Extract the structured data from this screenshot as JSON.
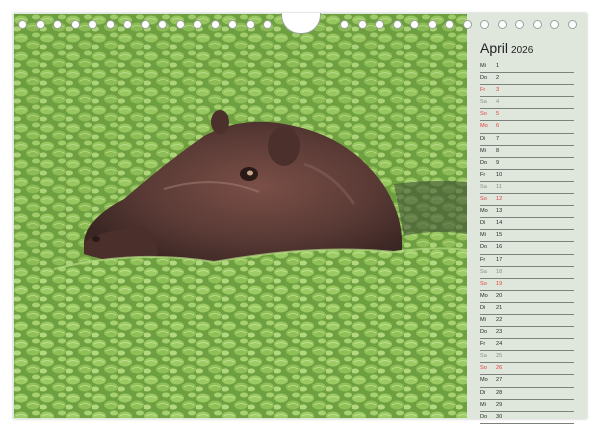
{
  "calendar": {
    "month": "April",
    "year": "2026",
    "days": [
      {
        "dn": "Mi",
        "num": "1",
        "type": "wd"
      },
      {
        "dn": "Do",
        "num": "2",
        "type": "wd"
      },
      {
        "dn": "Fr",
        "num": "3",
        "type": "holiday"
      },
      {
        "dn": "Sa",
        "num": "4",
        "type": "sat"
      },
      {
        "dn": "So",
        "num": "5",
        "type": "sun"
      },
      {
        "dn": "Mo",
        "num": "6",
        "type": "holiday"
      },
      {
        "dn": "Di",
        "num": "7",
        "type": "wd"
      },
      {
        "dn": "Mi",
        "num": "8",
        "type": "wd"
      },
      {
        "dn": "Do",
        "num": "9",
        "type": "wd"
      },
      {
        "dn": "Fr",
        "num": "10",
        "type": "wd"
      },
      {
        "dn": "Sa",
        "num": "11",
        "type": "sat"
      },
      {
        "dn": "So",
        "num": "12",
        "type": "sun"
      },
      {
        "dn": "Mo",
        "num": "13",
        "type": "wd"
      },
      {
        "dn": "Di",
        "num": "14",
        "type": "wd"
      },
      {
        "dn": "Mi",
        "num": "15",
        "type": "wd"
      },
      {
        "dn": "Do",
        "num": "16",
        "type": "wd"
      },
      {
        "dn": "Fr",
        "num": "17",
        "type": "wd"
      },
      {
        "dn": "Sa",
        "num": "18",
        "type": "sat"
      },
      {
        "dn": "So",
        "num": "19",
        "type": "sun"
      },
      {
        "dn": "Mo",
        "num": "20",
        "type": "wd"
      },
      {
        "dn": "Di",
        "num": "21",
        "type": "wd"
      },
      {
        "dn": "Mi",
        "num": "22",
        "type": "wd"
      },
      {
        "dn": "Do",
        "num": "23",
        "type": "wd"
      },
      {
        "dn": "Fr",
        "num": "24",
        "type": "wd"
      },
      {
        "dn": "Sa",
        "num": "25",
        "type": "sat"
      },
      {
        "dn": "So",
        "num": "26",
        "type": "sun"
      },
      {
        "dn": "Mo",
        "num": "27",
        "type": "wd"
      },
      {
        "dn": "Di",
        "num": "28",
        "type": "wd"
      },
      {
        "dn": "Mi",
        "num": "29",
        "type": "wd"
      },
      {
        "dn": "Do",
        "num": "30",
        "type": "wd"
      }
    ]
  },
  "colors": {
    "page": "#dfe6dc",
    "sunday": "#e0413a",
    "saturday": "#8a8f8a",
    "water_lettuce": "#7fb04a",
    "hippo": "#5a3a35"
  },
  "photo": {
    "subject": "hippo-in-water-lettuce"
  }
}
